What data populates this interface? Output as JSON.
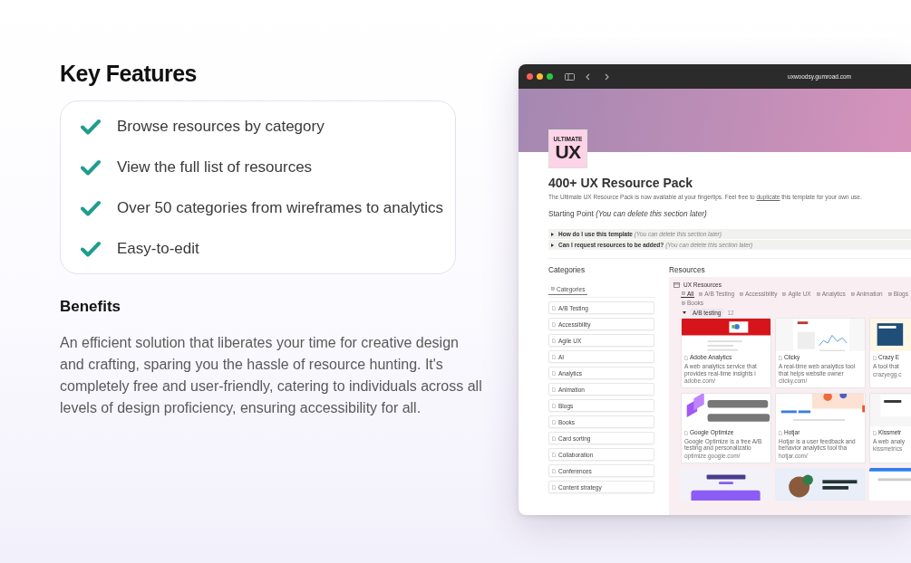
{
  "features_section": {
    "title": "Key Features",
    "features": [
      {
        "text": "Browse resources by category"
      },
      {
        "text": "View the full list of resources"
      },
      {
        "text": "Over 50 categories from wireframes to analytics"
      },
      {
        "text": "Easy-to-edit"
      }
    ]
  },
  "benefits": {
    "title": "Benefits",
    "text": "An efficient solution that liberates your time for creative design and crafting, sparing you the hassle of resource hunting. It's completely free and user-friendly, catering to individuals across all levels of design proficiency, ensuring accessibility for all."
  },
  "browser": {
    "url": "uxwoodsy.gumroad.com",
    "page": {
      "logo_small": "ULTIMATE",
      "logo_large": "UX",
      "title": "400+ UX Resource Pack",
      "description": {
        "before": "The Ultimate UX Resource Pack is now available at your fingertips. Feel free to ",
        "link": "duplicate",
        "after": " this template for your own use."
      },
      "section_heading": "Starting Point *(You can delete this section later)*",
      "toggles": [
        {
          "label": "How do I use this template",
          "note": "(You can delete this section later)",
          "expanded": false
        },
        {
          "label": "Can I request resources to be added?",
          "note": "(You can delete this section later)",
          "expanded": false
        }
      ],
      "categories": {
        "heading": "Categories",
        "view_tab": "Categories",
        "items": [
          "A/B Testing",
          "Accessibility",
          "Agile UX",
          "AI",
          "Analytics",
          "Animation",
          "Blogs",
          "Books",
          "Card sorting",
          "Collaboration",
          "Conferences",
          "Content strategy"
        ]
      },
      "resources": {
        "heading": "Resources",
        "database": "UX Resources",
        "tabs": [
          {
            "label": "All",
            "selected": true
          },
          {
            "label": "A/B Testing",
            "selected": false
          },
          {
            "label": "Accessibility",
            "selected": false
          },
          {
            "label": "Agile UX",
            "selected": false
          },
          {
            "label": "Analytics",
            "selected": false
          },
          {
            "label": "Animation",
            "selected": false
          },
          {
            "label": "Blogs",
            "selected": false
          },
          {
            "label": "Books",
            "selected": false
          }
        ],
        "group": {
          "label": "A/B testing",
          "count": "12",
          "expanded": true
        },
        "cards": [
          {
            "kind": "card",
            "name": "Adobe Analytics",
            "description": "A web analytics service that provides real-time insights i",
            "url": "adobe.com/"
          },
          {
            "kind": "card",
            "name": "Clicky",
            "description": "A real-time web analytics tool that helps website owner",
            "url": "clicky.com/"
          },
          {
            "kind": "card",
            "name": "Crazy E",
            "description": "A tool that",
            "url": "crazyegg.c"
          },
          {
            "kind": "card",
            "name": "Google Optimize",
            "description": "Google Optimize is a free A/B testing and personalizatio",
            "url": "optimize.google.com/"
          },
          {
            "kind": "card",
            "name": "Hotjar",
            "description": "Hotjar is a user feedback and behavior analytics tool tha",
            "url": "hotjar.com/"
          },
          {
            "kind": "card",
            "name": "Kissmetr",
            "description": "A web analy",
            "url": "kissmetrics"
          },
          {
            "kind": "picture"
          },
          {
            "kind": "picture"
          },
          {
            "kind": "picture"
          }
        ]
      }
    }
  }
}
